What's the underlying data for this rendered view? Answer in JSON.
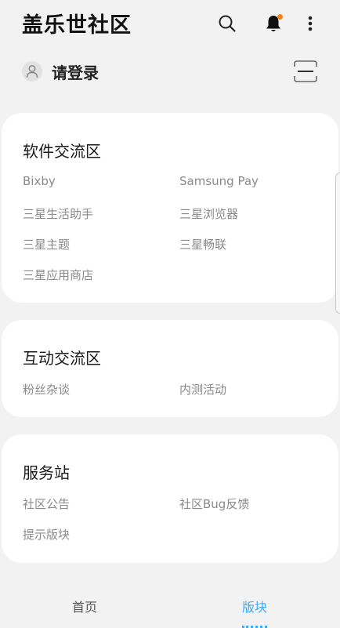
{
  "header": {
    "title": "盖乐世社区",
    "icons": [
      "search-icon",
      "bell-icon",
      "more-vertical-icon"
    ],
    "notification_dot_color": "#f58220"
  },
  "account": {
    "login_label": "请登录",
    "avatar_icon": "user-icon",
    "scan_icon": "scan-icon"
  },
  "sections": [
    {
      "title": "软件交流区",
      "items": [
        "Bixby",
        "Samsung Pay",
        "三星生活助手",
        "三星浏览器",
        "三星主题",
        "三星畅联",
        "三星应用商店"
      ]
    },
    {
      "title": "互动交流区",
      "items": [
        "粉丝杂谈",
        "内测活动"
      ]
    },
    {
      "title": "服务站",
      "items": [
        "社区公告",
        "社区Bug反馈",
        "提示版块"
      ]
    }
  ],
  "nav": {
    "home": "首页",
    "boards": "版块",
    "active": "版块",
    "active_color": "#3fa9f5",
    "inactive_color": "#555555"
  }
}
